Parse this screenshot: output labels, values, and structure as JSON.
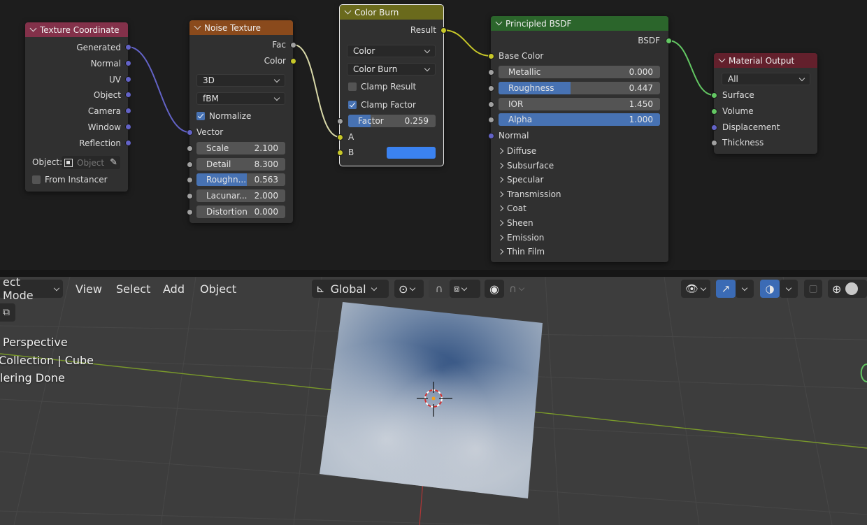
{
  "nodes": {
    "texture_coordinate": {
      "title": "Texture Coordinate",
      "outputs": [
        "Generated",
        "Normal",
        "UV",
        "Object",
        "Camera",
        "Window",
        "Reflection"
      ],
      "object_label": "Object:",
      "object_placeholder": "Object",
      "from_instancer": "From Instancer"
    },
    "noise_texture": {
      "title": "Noise Texture",
      "outputs": [
        "Fac",
        "Color"
      ],
      "dimension": "3D",
      "type": "fBM",
      "normalize": "Normalize",
      "vector_input": "Vector",
      "fields": [
        {
          "label": "Scale",
          "value": "2.100",
          "fill": 0
        },
        {
          "label": "Detail",
          "value": "8.300",
          "fill": 0
        },
        {
          "label": "Roughn...",
          "value": "0.563",
          "fill": 0.563
        },
        {
          "label": "Lacunar...",
          "value": "2.000",
          "fill": 0
        },
        {
          "label": "Distortion",
          "value": "0.000",
          "fill": 0
        }
      ]
    },
    "color_burn": {
      "title": "Color Burn",
      "output": "Result",
      "data_type": "Color",
      "blend_mode": "Color Burn",
      "clamp_result": "Clamp Result",
      "clamp_factor": "Clamp Factor",
      "factor_label": "Factor",
      "factor_value": "0.259",
      "factor_fill": 0.259,
      "input_a": "A",
      "input_b": "B",
      "b_color": "#3b82f0"
    },
    "principled_bsdf": {
      "title": "Principled BSDF",
      "output": "BSDF",
      "base_color": "Base Color",
      "fields": [
        {
          "label": "Metallic",
          "value": "0.000",
          "fill": 0
        },
        {
          "label": "Roughness",
          "value": "0.447",
          "fill": 0.447
        },
        {
          "label": "IOR",
          "value": "1.450",
          "fill": 0
        },
        {
          "label": "Alpha",
          "value": "1.000",
          "fill": 1.0
        }
      ],
      "normal": "Normal",
      "panels": [
        "Diffuse",
        "Subsurface",
        "Specular",
        "Transmission",
        "Coat",
        "Sheen",
        "Emission",
        "Thin Film"
      ]
    },
    "material_output": {
      "title": "Material Output",
      "target": "All",
      "inputs": [
        "Surface",
        "Volume",
        "Displacement",
        "Thickness"
      ]
    }
  },
  "viewport": {
    "mode": "ect Mode",
    "menus": [
      "View",
      "Select",
      "Add",
      "Object"
    ],
    "transform_orientation": "Global",
    "overlay_lines": [
      "Perspective",
      "Collection | Cube",
      "lering Done"
    ]
  },
  "colors": {
    "accent": "#4772b3",
    "socket_vector": "#6363c7",
    "socket_color": "#c7c729",
    "socket_shader": "#63c763",
    "socket_float": "#a1a1a1"
  },
  "icons": [
    "object-eyedropper-icon",
    "transform-orientation-icon",
    "pivot-icon",
    "snap-magnet-icon",
    "snap-grid-icon",
    "proportional-edit-icon",
    "falloff-icon",
    "visibility-eye-icon",
    "gizmo-icon",
    "overlay-icon",
    "xray-icon",
    "wireframe-shading-icon",
    "solid-shading-icon",
    "camera-view-icon"
  ]
}
